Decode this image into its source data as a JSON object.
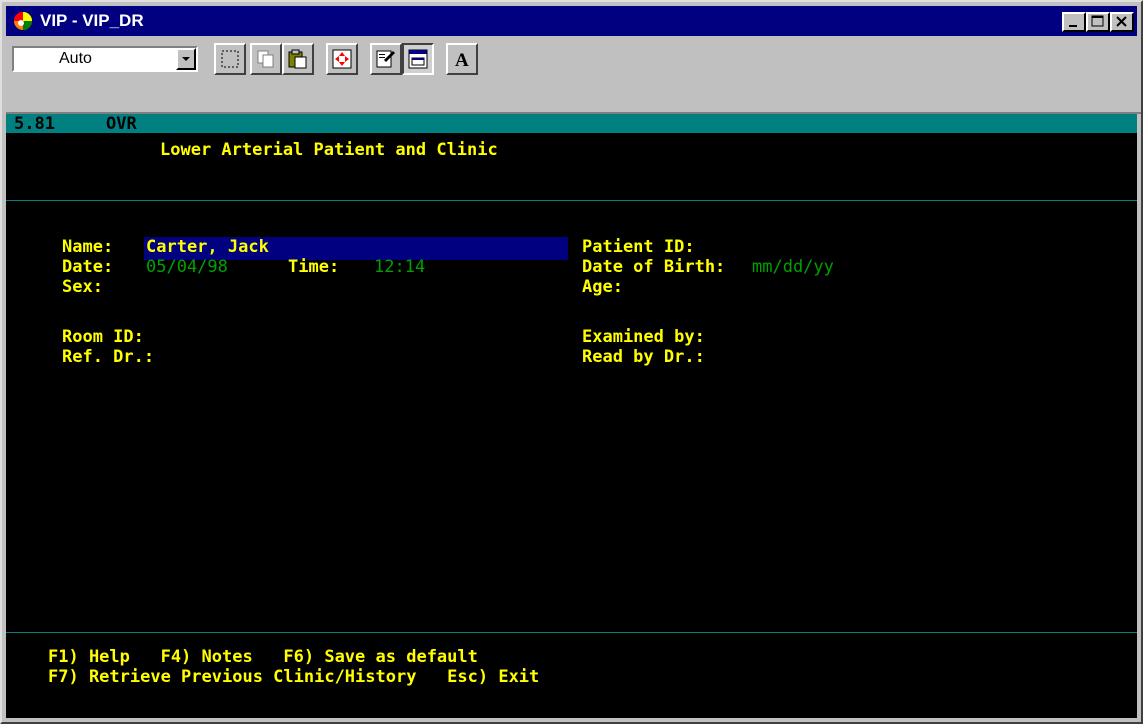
{
  "window": {
    "title": "VIP - VIP_DR",
    "icon": "vip-app-icon",
    "controls": [
      "minimize-icon",
      "maximize-icon",
      "close-icon"
    ]
  },
  "toolbar": {
    "font_size_value": "Auto",
    "buttons": [
      "mark-icon",
      "copy-icon",
      "paste-icon",
      "fullscreen-icon",
      "properties-icon",
      "background-icon",
      "font-icon"
    ]
  },
  "console": {
    "status_left": "5.81",
    "status_mode": "OVR",
    "header": "Lower Arterial Patient and Clinic",
    "fields": {
      "name_label": "Name:",
      "name_value": "Carter, Jack",
      "date_label": "Date:",
      "date_value": "05/04/98",
      "time_label": "Time:",
      "time_value": "12:14",
      "sex_label": "Sex:",
      "patient_id_label": "Patient ID:",
      "dob_label": "Date of Birth:",
      "dob_value": "mm/dd/yy",
      "age_label": "Age:",
      "room_id_label": "Room ID:",
      "ref_dr_label": "Ref. Dr.:",
      "examined_by_label": "Examined by:",
      "read_by_label": "Read by Dr.:"
    },
    "footer": {
      "line1": "F1) Help   F4) Notes   F6) Save as default",
      "line2": "F7) Retrieve Previous Clinic/History   Esc) Exit"
    }
  },
  "colors": {
    "titlebar": "#000080",
    "teal": "#008080",
    "label": "#ffff00",
    "value_dim": "#00a000",
    "console_bg": "#000000"
  }
}
